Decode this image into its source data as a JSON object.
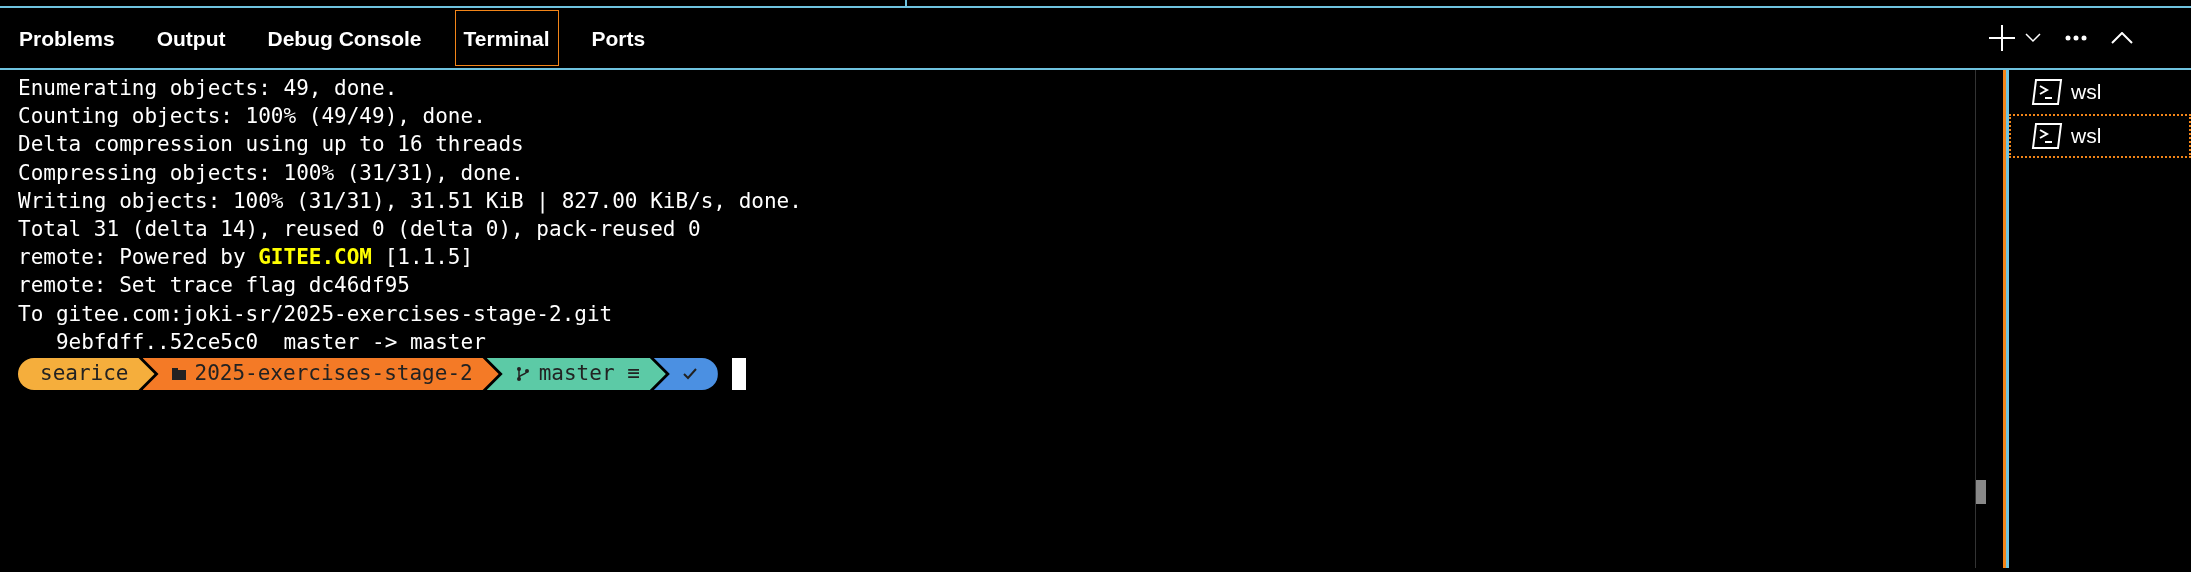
{
  "tabs": [
    {
      "label": "Problems",
      "selected": false
    },
    {
      "label": "Output",
      "selected": false
    },
    {
      "label": "Debug Console",
      "selected": false
    },
    {
      "label": "Terminal",
      "selected": true
    },
    {
      "label": "Ports",
      "selected": false
    }
  ],
  "terminal": {
    "lines": [
      "Enumerating objects: 49, done.",
      "Counting objects: 100% (49/49), done.",
      "Delta compression using up to 16 threads",
      "Compressing objects: 100% (31/31), done.",
      "Writing objects: 100% (31/31), 31.51 KiB | 827.00 KiB/s, done.",
      "Total 31 (delta 14), reused 0 (delta 0), pack-reused 0",
      "remote: Powered by **GITEE.COM** [1.1.5]",
      "remote: Set trace flag dc46df95",
      "To gitee.com:joki-sr/2025-exercises-stage-2.git",
      "   9ebfdff..52ce5c0  master -> master"
    ],
    "prompt": [
      {
        "kind": "user",
        "text": "searice",
        "color": "#f5ae3c"
      },
      {
        "kind": "folder",
        "text": "2025-exercises-stage-2",
        "color": "#f47a26"
      },
      {
        "kind": "git",
        "text": "master ≡",
        "color": "#5ccaa6"
      },
      {
        "kind": "status",
        "color": "#4b90e2"
      }
    ]
  },
  "terminal_list": [
    {
      "label": "wsl",
      "focused": false
    },
    {
      "label": "wsl",
      "focused": true
    }
  ]
}
